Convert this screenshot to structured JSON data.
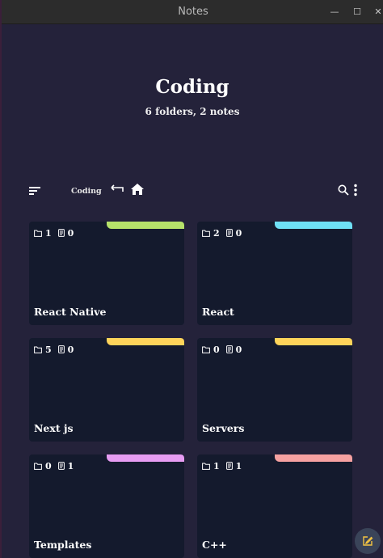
{
  "window": {
    "title": "Notes"
  },
  "header": {
    "title": "Coding",
    "subtitle": "6 folders, 2 notes"
  },
  "toolbar": {
    "breadcrumb": "Coding"
  },
  "folders": [
    {
      "name": "React Native",
      "folders": "1",
      "notes": "0",
      "color": "#b6e26a"
    },
    {
      "name": "React",
      "folders": "2",
      "notes": "0",
      "color": "#6fe0f5"
    },
    {
      "name": "Next js",
      "folders": "5",
      "notes": "0",
      "color": "#ffd45a"
    },
    {
      "name": "Servers",
      "folders": "0",
      "notes": "0",
      "color": "#ffd45a"
    },
    {
      "name": "Templates",
      "folders": "0",
      "notes": "1",
      "color": "#e79cf2"
    },
    {
      "name": "C++",
      "folders": "1",
      "notes": "1",
      "color": "#f6a1a1"
    }
  ],
  "icons": {
    "fab": "edit-icon",
    "sort": "sort-icon",
    "back": "back-arrow-icon",
    "home": "home-icon",
    "search": "search-icon",
    "more": "more-vert-icon",
    "folder": "folder-icon",
    "note": "note-icon"
  }
}
